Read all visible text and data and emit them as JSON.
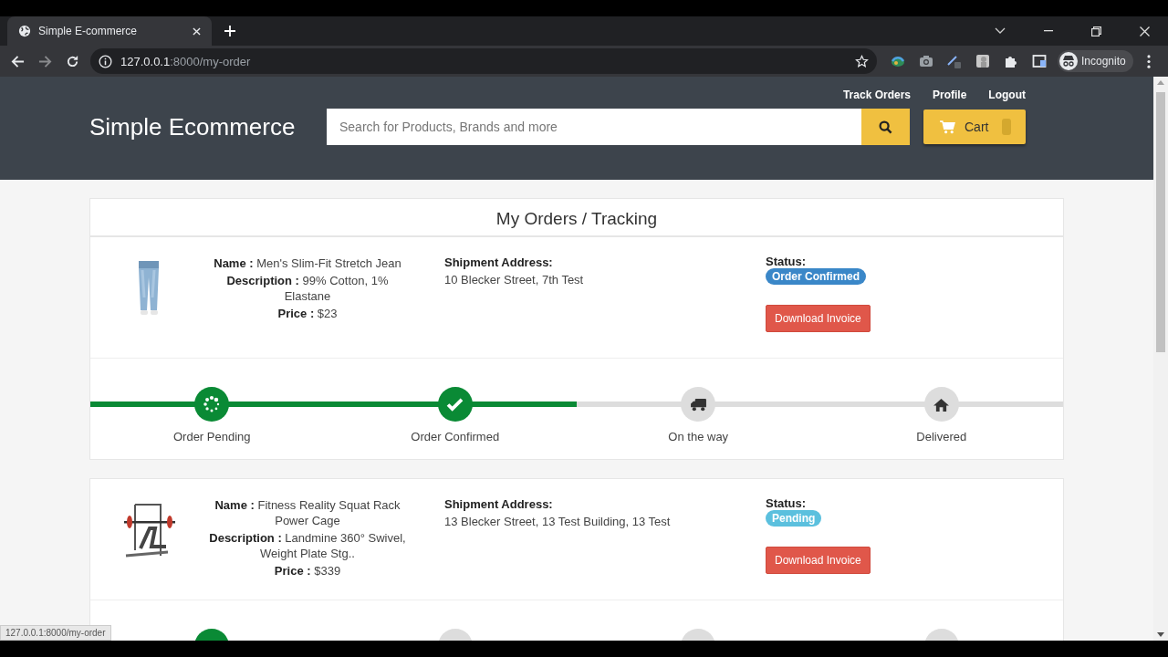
{
  "browser": {
    "tab": {
      "title": "Simple E-commerce"
    },
    "address": {
      "host": "127.0.0.1",
      "path": ":8000/my-order"
    },
    "profile": "Incognito",
    "status_url": "127.0.0.1:8000/my-order"
  },
  "header": {
    "logo": "Simple Ecommerce",
    "nav": [
      "Track Orders",
      "Profile",
      "Logout"
    ],
    "search": {
      "placeholder": "Search for Products, Brands and more"
    },
    "cart": {
      "label": "Cart"
    }
  },
  "page_title": "My Orders / Tracking",
  "orders": [
    {
      "name": "**Name :** Men's Slim-Fit Stretch Jean",
      "description": "**Description :** 99% Cotton, 1% Elastane",
      "price": "**Price :** $23",
      "address_label": "Shipment Address:",
      "address": "10 Blecker Street, 7th Test",
      "status_label": "Status:",
      "status": {
        "text": "Order Confirmed",
        "color": "#3a87c8"
      },
      "invoice_button": "Download Invoice",
      "tracker": {
        "level": 0.5,
        "steps": [
          {
            "kind": "pending",
            "label": "Order Pending",
            "done": true
          },
          {
            "kind": "confirmed",
            "label": "Order Confirmed",
            "done": true
          },
          {
            "kind": "shipping",
            "label": "On the way",
            "done": false
          },
          {
            "kind": "delivered",
            "label": "Delivered",
            "done": false
          }
        ]
      }
    },
    {
      "name": "**Name :** Fitness Reality Squat Rack Power Cage",
      "description": "**Description :** Landmine 360° Swivel, Weight Plate Stg..",
      "price": "**Price :** $339",
      "address_label": "Shipment Address:",
      "address": "13 Blecker Street, 13 Test Building, 13 Test",
      "status_label": "Status:",
      "status": {
        "text": "Pending",
        "color": "#5bc0de"
      },
      "invoice_button": "Download Invoice",
      "tracker": {
        "steps": [
          {
            "done": true
          },
          {
            "done": false
          },
          {
            "done": false
          },
          {
            "done": false
          }
        ]
      }
    }
  ]
}
